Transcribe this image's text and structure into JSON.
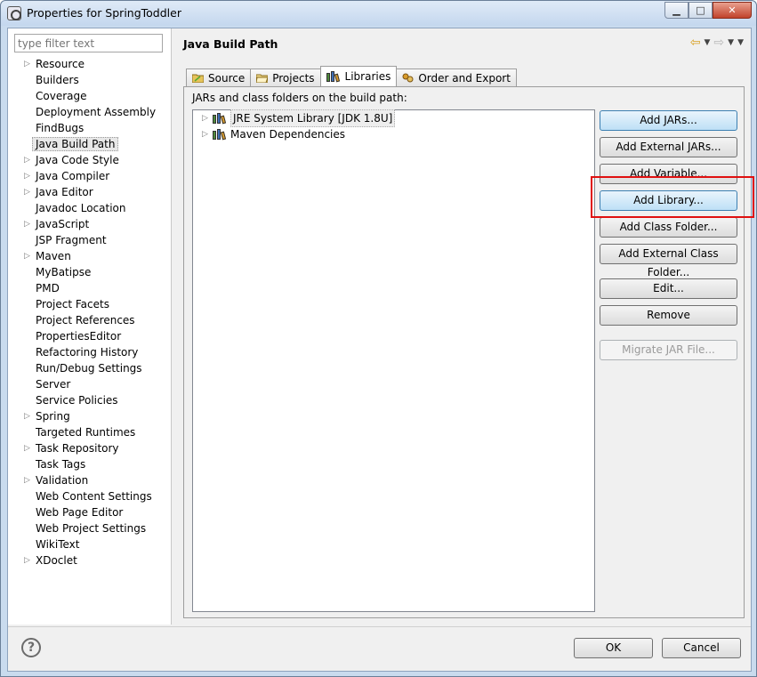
{
  "window": {
    "title": "Properties for SpringToddler",
    "minimize": "▁",
    "maximize": "□",
    "close": "✕"
  },
  "sidebar": {
    "filter_placeholder": "type filter text",
    "items": [
      {
        "label": "Resource",
        "expandable": true
      },
      {
        "label": "Builders",
        "expandable": false
      },
      {
        "label": "Coverage",
        "expandable": false
      },
      {
        "label": "Deployment Assembly",
        "expandable": false
      },
      {
        "label": "FindBugs",
        "expandable": false
      },
      {
        "label": "Java Build Path",
        "expandable": false,
        "selected": true
      },
      {
        "label": "Java Code Style",
        "expandable": true
      },
      {
        "label": "Java Compiler",
        "expandable": true
      },
      {
        "label": "Java Editor",
        "expandable": true
      },
      {
        "label": "Javadoc Location",
        "expandable": false
      },
      {
        "label": "JavaScript",
        "expandable": true
      },
      {
        "label": "JSP Fragment",
        "expandable": false
      },
      {
        "label": "Maven",
        "expandable": true
      },
      {
        "label": "MyBatipse",
        "expandable": false
      },
      {
        "label": "PMD",
        "expandable": false
      },
      {
        "label": "Project Facets",
        "expandable": false
      },
      {
        "label": "Project References",
        "expandable": false
      },
      {
        "label": "PropertiesEditor",
        "expandable": false
      },
      {
        "label": "Refactoring History",
        "expandable": false
      },
      {
        "label": "Run/Debug Settings",
        "expandable": false
      },
      {
        "label": "Server",
        "expandable": false
      },
      {
        "label": "Service Policies",
        "expandable": false
      },
      {
        "label": "Spring",
        "expandable": true
      },
      {
        "label": "Targeted Runtimes",
        "expandable": false
      },
      {
        "label": "Task Repository",
        "expandable": true
      },
      {
        "label": "Task Tags",
        "expandable": false
      },
      {
        "label": "Validation",
        "expandable": true
      },
      {
        "label": "Web Content Settings",
        "expandable": false
      },
      {
        "label": "Web Page Editor",
        "expandable": false
      },
      {
        "label": "Web Project Settings",
        "expandable": false
      },
      {
        "label": "WikiText",
        "expandable": false
      },
      {
        "label": "XDoclet",
        "expandable": true
      }
    ]
  },
  "main": {
    "title": "Java Build Path",
    "tabs": [
      {
        "label": "Source",
        "icon": "source-folder-icon"
      },
      {
        "label": "Projects",
        "icon": "projects-folder-icon"
      },
      {
        "label": "Libraries",
        "icon": "library-icon",
        "active": true
      },
      {
        "label": "Order and Export",
        "icon": "order-export-icon"
      }
    ],
    "list_label": "JARs and class folders on the build path:",
    "tree": [
      {
        "label": "JRE System Library [JDK 1.8U]",
        "selected": true
      },
      {
        "label": "Maven Dependencies",
        "selected": false
      }
    ],
    "buttons": {
      "add_jars": "Add JARs...",
      "add_external_jars": "Add External JARs...",
      "add_variable": "Add Variable...",
      "add_library": "Add Library...",
      "add_class_folder": "Add Class Folder...",
      "add_external_class_folder": "Add External Class Folder...",
      "edit": "Edit...",
      "remove": "Remove",
      "migrate_jar": "Migrate JAR File..."
    }
  },
  "footer": {
    "help": "?",
    "ok": "OK",
    "cancel": "Cancel"
  },
  "colors": {
    "highlight": "#e01010"
  }
}
